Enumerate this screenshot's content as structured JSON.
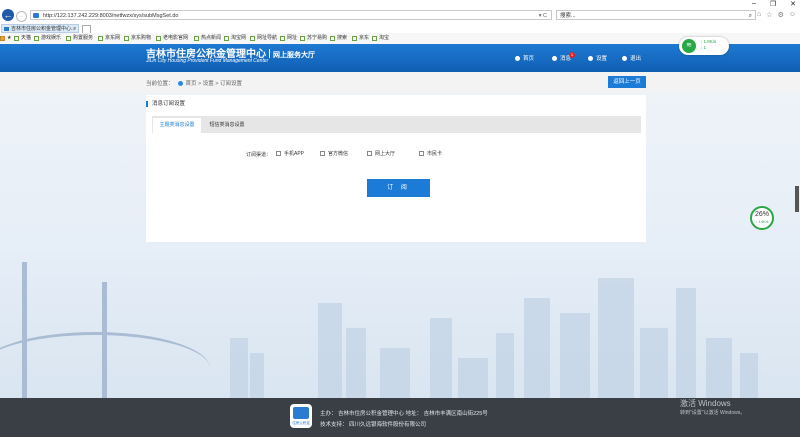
{
  "browser": {
    "address": "http://122.137.242.229:8003/netfwzx/sys/subMsgSet.do",
    "search_placeholder": "搜索...",
    "tab_title": "吉林市住房公积金管理中心...",
    "favorites": [
      "天猫",
      "游戏娱乐",
      "购置服务",
      "京东网",
      "京东购物",
      "老电影官网",
      "热点新闻",
      "淘宝网",
      "网址导航",
      "网址",
      "苏宁易购",
      "搜索",
      "京东",
      "淘宝"
    ],
    "win_min": "–",
    "win_max": "❐",
    "win_close": "✕",
    "net_speed_up": "↑ 1.8K/s",
    "net_speed_down": "↓ 1"
  },
  "header": {
    "org_name": "吉林市住房公积金管理中心",
    "sub_name": "网上服务大厅",
    "org_name_en": "JiLin City Housing Provident Fund Management Center",
    "nav": {
      "home": "首页",
      "messages": "消息",
      "settings": "设置",
      "logout": "退出"
    },
    "message_badge": "1"
  },
  "breadcrumb": {
    "label": "当前位置：",
    "path": "首页 > 设置 > 订阅设置"
  },
  "back_button": "返回上一页",
  "panel": {
    "title": "消息订阅设置",
    "tabs": [
      "主题类消息设置",
      "短信类消息设置"
    ],
    "channel_label": "订阅渠道：",
    "channels": [
      "手机APP",
      "官方微信",
      "网上大厅",
      "市民卡"
    ],
    "subscribe_button": "订 阅"
  },
  "gauge": {
    "percent": "26%",
    "speed": "↑ 1.6K/s"
  },
  "footer": {
    "host_line": "主办： 吉林市住房公积金管理中心  地址： 吉林市丰满区南山街225号",
    "support_line": "技术支持： 四川久远银海软件股份有限公司",
    "logo_text": "住房公积金"
  },
  "watermark": {
    "line1": "激活 Windows",
    "line2": "转到\"设置\"以激活 Windows。"
  }
}
